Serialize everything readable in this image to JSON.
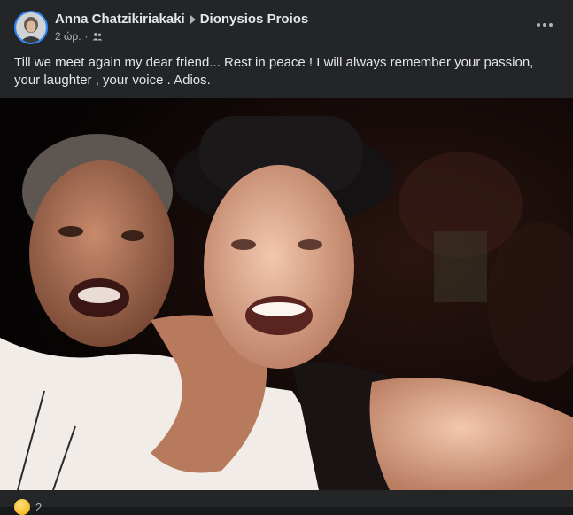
{
  "post": {
    "author": "Anna Chatzikiriakaki",
    "recipient": "Dionysios Proios",
    "time": "2 ώρ.",
    "separator": "·",
    "audience_icon": "friends-icon",
    "menu_icon": "more-options-icon",
    "text": "Till we meet again my dear friend... Rest in peace ! I will always remember your passion, your laughter , your voice . Adios."
  },
  "footer": {
    "reaction_icon": "sad-face-icon",
    "reaction_count": "2"
  },
  "colors": {
    "background": "#242526",
    "text": "#e4e6eb",
    "secondary_text": "#b0b3b8",
    "avatar_ring": "#2d88ff"
  }
}
